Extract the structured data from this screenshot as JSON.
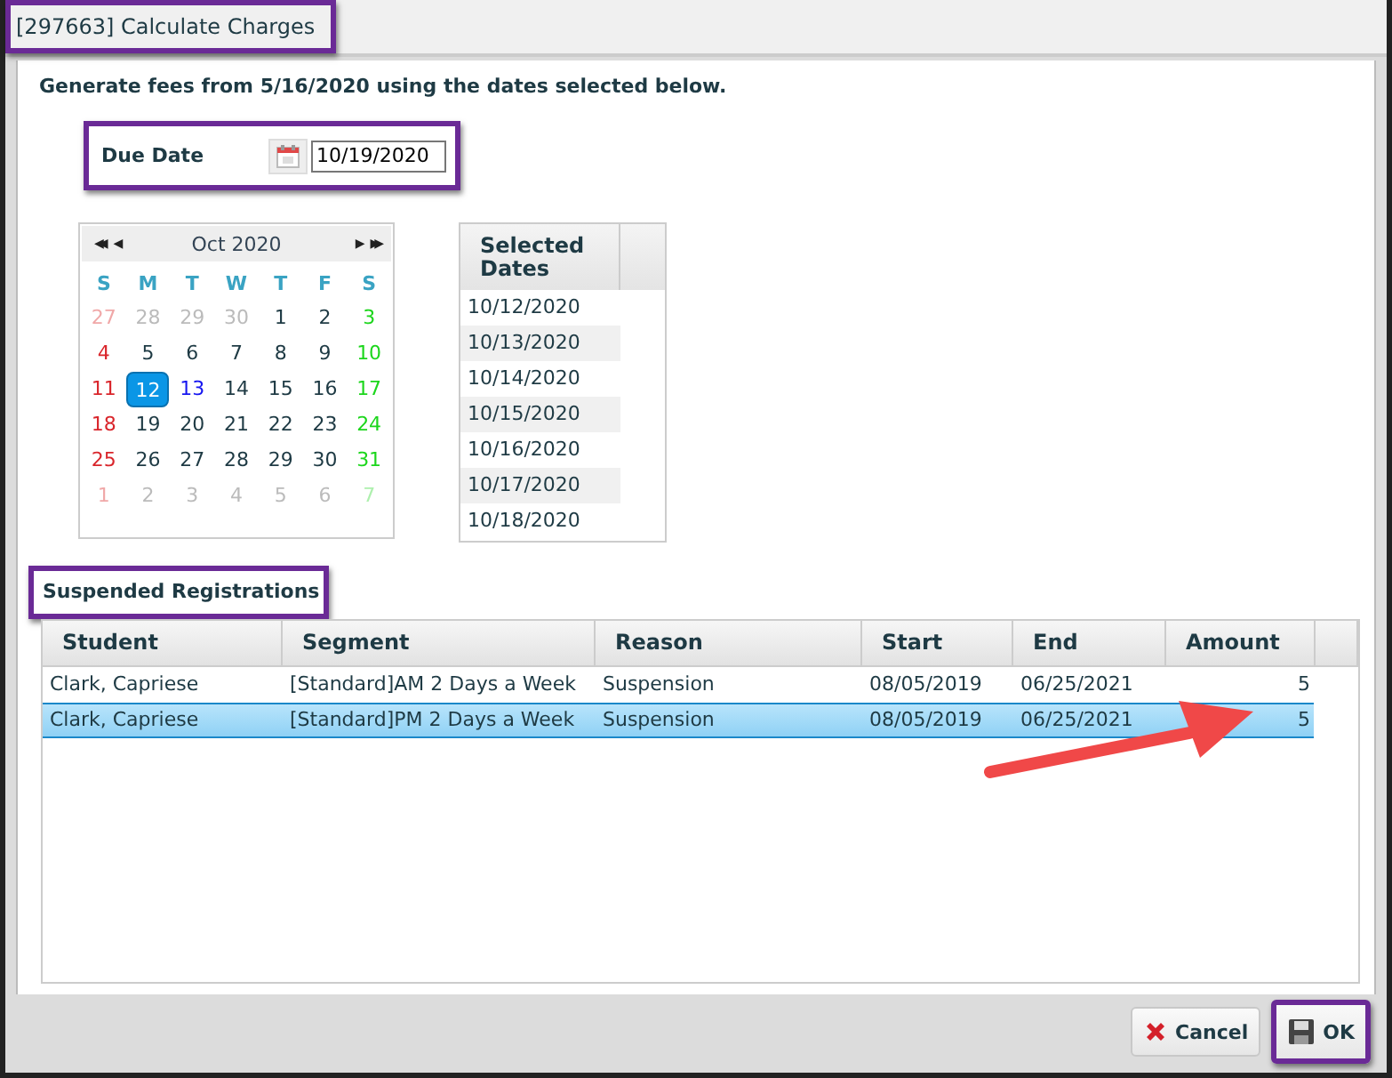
{
  "window": {
    "title": "[297663] Calculate Charges",
    "highlighted": true
  },
  "intro": "Generate fees from 5/16/2020 using the dates selected below.",
  "due_date": {
    "label": "Due Date",
    "value": "10/19/2020",
    "highlighted": true
  },
  "calendar": {
    "month": "Oct 2020",
    "first": "◀◀",
    "prev": "◀",
    "next": "▶",
    "last": "▶▶",
    "weekdays": [
      "S",
      "M",
      "T",
      "W",
      "T",
      "F",
      "S"
    ],
    "days": [
      {
        "day": "27",
        "kind": "sunday",
        "outside": true,
        "selected": false
      },
      {
        "day": "28",
        "kind": "weekday",
        "outside": true,
        "selected": false
      },
      {
        "day": "29",
        "kind": "weekday",
        "outside": true,
        "selected": false
      },
      {
        "day": "30",
        "kind": "weekday",
        "outside": true,
        "selected": false
      },
      {
        "day": "1",
        "kind": "weekday",
        "outside": false,
        "selected": false
      },
      {
        "day": "2",
        "kind": "weekday",
        "outside": false,
        "selected": false
      },
      {
        "day": "3",
        "kind": "saturday",
        "outside": false,
        "selected": false
      },
      {
        "day": "4",
        "kind": "sunday",
        "outside": false,
        "selected": false
      },
      {
        "day": "5",
        "kind": "weekday",
        "outside": false,
        "selected": false
      },
      {
        "day": "6",
        "kind": "weekday",
        "outside": false,
        "selected": false
      },
      {
        "day": "7",
        "kind": "weekday",
        "outside": false,
        "selected": false
      },
      {
        "day": "8",
        "kind": "weekday",
        "outside": false,
        "selected": false
      },
      {
        "day": "9",
        "kind": "weekday",
        "outside": false,
        "selected": false
      },
      {
        "day": "10",
        "kind": "saturday",
        "outside": false,
        "selected": false
      },
      {
        "day": "11",
        "kind": "sunday",
        "outside": false,
        "selected": false
      },
      {
        "day": "12",
        "kind": "weekday",
        "outside": false,
        "selected": true
      },
      {
        "day": "13",
        "kind": "today",
        "outside": false,
        "selected": false
      },
      {
        "day": "14",
        "kind": "weekday",
        "outside": false,
        "selected": false
      },
      {
        "day": "15",
        "kind": "weekday",
        "outside": false,
        "selected": false
      },
      {
        "day": "16",
        "kind": "weekday",
        "outside": false,
        "selected": false
      },
      {
        "day": "17",
        "kind": "saturday",
        "outside": false,
        "selected": false
      },
      {
        "day": "18",
        "kind": "sunday",
        "outside": false,
        "selected": false
      },
      {
        "day": "19",
        "kind": "weekday",
        "outside": false,
        "selected": false
      },
      {
        "day": "20",
        "kind": "weekday",
        "outside": false,
        "selected": false
      },
      {
        "day": "21",
        "kind": "weekday",
        "outside": false,
        "selected": false
      },
      {
        "day": "22",
        "kind": "weekday",
        "outside": false,
        "selected": false
      },
      {
        "day": "23",
        "kind": "weekday",
        "outside": false,
        "selected": false
      },
      {
        "day": "24",
        "kind": "saturday",
        "outside": false,
        "selected": false
      },
      {
        "day": "25",
        "kind": "sunday",
        "outside": false,
        "selected": false
      },
      {
        "day": "26",
        "kind": "weekday",
        "outside": false,
        "selected": false
      },
      {
        "day": "27",
        "kind": "weekday",
        "outside": false,
        "selected": false
      },
      {
        "day": "28",
        "kind": "weekday",
        "outside": false,
        "selected": false
      },
      {
        "day": "29",
        "kind": "weekday",
        "outside": false,
        "selected": false
      },
      {
        "day": "30",
        "kind": "weekday",
        "outside": false,
        "selected": false
      },
      {
        "day": "31",
        "kind": "saturday",
        "outside": false,
        "selected": false
      },
      {
        "day": "1",
        "kind": "sunday",
        "outside": true,
        "selected": false
      },
      {
        "day": "2",
        "kind": "weekday",
        "outside": true,
        "selected": false
      },
      {
        "day": "3",
        "kind": "weekday",
        "outside": true,
        "selected": false
      },
      {
        "day": "4",
        "kind": "weekday",
        "outside": true,
        "selected": false
      },
      {
        "day": "5",
        "kind": "weekday",
        "outside": true,
        "selected": false
      },
      {
        "day": "6",
        "kind": "weekday",
        "outside": true,
        "selected": false
      },
      {
        "day": "7",
        "kind": "saturday",
        "outside": true,
        "selected": false
      }
    ]
  },
  "selected_dates": {
    "heading": "Selected Dates",
    "items": [
      "10/12/2020",
      "10/13/2020",
      "10/14/2020",
      "10/15/2020",
      "10/16/2020",
      "10/17/2020",
      "10/18/2020"
    ]
  },
  "suspended": {
    "heading": "Suspended Registrations",
    "highlighted": true,
    "columns": [
      "Student",
      "Segment",
      "Reason",
      "Start",
      "End",
      "Amount"
    ],
    "rows": [
      {
        "cells": [
          "Clark, Capriese",
          "[Standard]AM 2 Days a Week",
          "Suspension",
          "08/05/2019",
          "06/25/2021",
          "5"
        ],
        "selected": false
      },
      {
        "cells": [
          "Clark, Capriese",
          "[Standard]PM 2 Days a Week",
          "Suspension",
          "08/05/2019",
          "06/25/2021",
          "5"
        ],
        "selected": true
      }
    ]
  },
  "annotation_arrow": true,
  "buttons": [
    {
      "kind": "cancel",
      "label": "Cancel",
      "highlighted": false
    },
    {
      "kind": "ok",
      "label": "OK",
      "highlighted": true
    }
  ]
}
